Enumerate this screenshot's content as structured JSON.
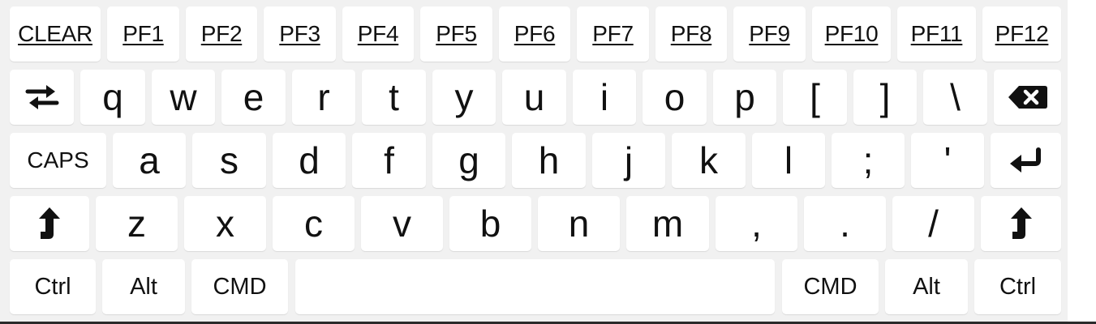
{
  "keyboard": {
    "function_row": [
      "CLEAR",
      "PF1",
      "PF2",
      "PF3",
      "PF4",
      "PF5",
      "PF6",
      "PF7",
      "PF8",
      "PF9",
      "PF10",
      "PF11",
      "PF12"
    ],
    "row_q": [
      "q",
      "w",
      "e",
      "r",
      "t",
      "y",
      "u",
      "i",
      "o",
      "p",
      "[",
      "]",
      "\\"
    ],
    "row_a": [
      "a",
      "s",
      "d",
      "f",
      "g",
      "h",
      "j",
      "k",
      "l",
      ";",
      "'"
    ],
    "row_z": [
      "z",
      "x",
      "c",
      "v",
      "b",
      "n",
      "m",
      ",",
      ".",
      "/"
    ],
    "caps_label": "CAPS",
    "bottom_row": {
      "left_ctrl": "Ctrl",
      "left_alt": "Alt",
      "left_cmd": "CMD",
      "right_cmd": "CMD",
      "right_alt": "Alt",
      "right_ctrl": "Ctrl"
    },
    "icons": {
      "tab": "tab-arrows-icon",
      "backspace": "backspace-icon",
      "enter": "enter-icon",
      "shift": "shift-arrow-icon"
    },
    "colors": {
      "background": "#f1f1f1",
      "key": "#ffffff",
      "text": "#111111"
    }
  }
}
